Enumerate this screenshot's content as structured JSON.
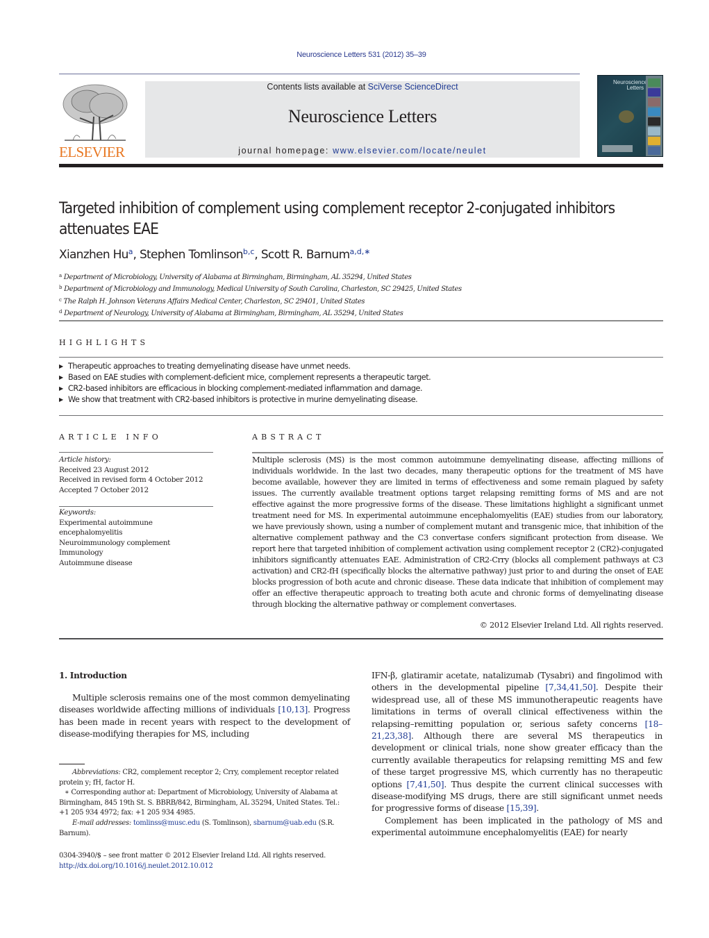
{
  "journal_ref": "Neuroscience Letters 531 (2012) 35–39",
  "masthead": {
    "contents_prefix": "Contents lists available at ",
    "contents_link": "SciVerse ScienceDirect",
    "journal_title": "Neuroscience Letters",
    "homepage_prefix": "journal homepage: ",
    "homepage_link": "www.elsevier.com/locate/neulet",
    "publisher_logo_text": "ELSEVIER",
    "cover_title_line1": "Neuroscience",
    "cover_title_line2": "Letters"
  },
  "colors": {
    "link": "#1f3a93",
    "elsevier_orange": "#e87722",
    "masthead_bg": "#e6e7e8"
  },
  "article": {
    "title": "Targeted inhibition of complement using complement receptor 2-conjugated inhibitors attenuates EAE",
    "authors": [
      {
        "name": "Xianzhen Hu",
        "sup": "a"
      },
      {
        "name": "Stephen Tomlinson",
        "sup": "b,c"
      },
      {
        "name": "Scott R. Barnum",
        "sup": "a,d,∗"
      }
    ],
    "affiliations": [
      {
        "mark": "a",
        "text": "Department of Microbiology, University of Alabama at Birmingham, Birmingham, AL 35294, United States"
      },
      {
        "mark": "b",
        "text": "Department of Microbiology and Immunology, Medical University of South Carolina, Charleston, SC 29425, United States"
      },
      {
        "mark": "c",
        "text": "The Ralph H. Johnson Veterans Affairs Medical Center, Charleston, SC 29401, United States"
      },
      {
        "mark": "d",
        "text": "Department of Neurology, University of Alabama at Birmingham, Birmingham, AL 35294, United States"
      }
    ]
  },
  "highlights": {
    "label": "HIGHLIGHTS",
    "items": [
      "Therapeutic approaches to treating demyelinating disease have unmet needs.",
      "Based on EAE studies with complement-deficient mice, complement represents a therapeutic target.",
      "CR2-based inhibitors are efficacious in blocking complement-mediated inflammation and damage.",
      "We show that treatment with CR2-based inhibitors is protective in murine demyelinating disease."
    ]
  },
  "article_info": {
    "label": "ARTICLE INFO",
    "history_label": "Article history:",
    "history": [
      "Received 23 August 2012",
      "Received in revised form 4 October 2012",
      "Accepted 7 October 2012"
    ],
    "keywords_label": "Keywords:",
    "keywords": [
      "Experimental autoimmune",
      "encephalomyelitis",
      "Neuroimmunology complement",
      "Immunology",
      "Autoimmune disease"
    ]
  },
  "abstract": {
    "label": "ABSTRACT",
    "text": "Multiple sclerosis (MS) is the most common autoimmune demyelinating disease, affecting millions of individuals worldwide. In the last two decades, many therapeutic options for the treatment of MS have become available, however they are limited in terms of effectiveness and some remain plagued by safety issues. The currently available treatment options target relapsing remitting forms of MS and are not effective against the more progressive forms of the disease. These limitations highlight a significant unmet treatment need for MS. In experimental autoimmune encephalomyelitis (EAE) studies from our laboratory, we have previously shown, using a number of complement mutant and transgenic mice, that inhibition of the alternative complement pathway and the C3 convertase confers significant protection from disease. We report here that targeted inhibition of complement activation using complement receptor 2 (CR2)-conjugated inhibitors significantly attenuates EAE. Administration of CR2-Crry (blocks all complement pathways at C3 activation) and CR2-fH (specifically blocks the alternative pathway) just prior to and during the onset of EAE blocks progression of both acute and chronic disease. These data indicate that inhibition of complement may offer an effective therapeutic approach to treating both acute and chronic forms of demyelinating disease through blocking the alternative pathway or complement convertases.",
    "copyright": "© 2012 Elsevier Ireland Ltd. All rights reserved."
  },
  "introduction": {
    "heading": "1.  Introduction",
    "left_p1_a": "Multiple sclerosis remains one of the most common demyelinating diseases worldwide affecting millions of individuals ",
    "left_p1_ref1": "[10,13]",
    "left_p1_b": ". Progress has been made in recent years with respect to the development of disease-modifying therapies for MS, including",
    "right_p1_a": "IFN-β, glatiramir acetate, natalizumab (Tysabri) and fingolimod with others in the developmental pipeline ",
    "right_p1_ref1": "[7,34,41,50]",
    "right_p1_b": ". Despite their widespread use, all of these MS immunotherapeutic reagents have limitations in terms of overall clinical effectiveness within the relapsing–remitting population or, serious safety concerns ",
    "right_p1_ref2": "[18–21,23,38]",
    "right_p1_c": ". Although there are several MS therapeutics in development or clinical trials, none show greater efficacy than the currently available therapeutics for relapsing remitting MS and few of these target progressive MS, which currently has no therapeutic options ",
    "right_p1_ref3": "[7,41,50]",
    "right_p1_d": ". Thus despite the current clinical successes with disease-modifying MS drugs, there are still significant unmet needs for progressive forms of disease ",
    "right_p1_ref4": "[15,39]",
    "right_p1_e": ".",
    "right_p2": "Complement has been implicated in the pathology of MS and experimental autoimmune encephalomyelitis (EAE) for nearly"
  },
  "footnotes": {
    "abbrev_label": "Abbreviations:",
    "abbrev_text": " CR2, complement receptor 2; Crry, complement receptor related protein y; fH, factor H.",
    "corresponding": "∗ Corresponding author at: Department of Microbiology, University of Alabama at Birmingham, 845 19th St. S. BBRB/842, Birmingham, AL 35294, United States. Tel.: +1 205 934 4972; fax: +1 205 934 4985.",
    "email_label": "E-mail addresses:",
    "email1": "tomlinss@musc.edu",
    "email1_owner": " (S. Tomlinson), ",
    "email2": "sbarnum@uab.edu",
    "email2_owner": " (S.R. Barnum).",
    "front_matter": "0304-3940/$ – see front matter © 2012 Elsevier Ireland Ltd. All rights reserved.",
    "doi": "http://dx.doi.org/10.1016/j.neulet.2012.10.012"
  }
}
